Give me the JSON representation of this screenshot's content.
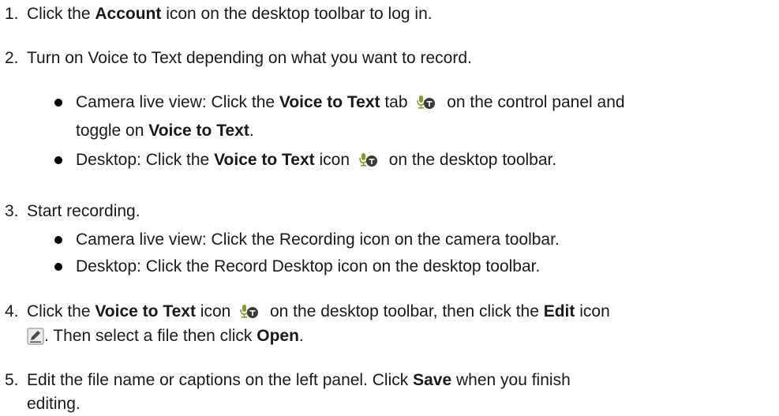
{
  "steps": [
    {
      "num": "1.",
      "t1": "Click the ",
      "b1": "Account",
      "t2": " icon on the desktop toolbar to log in."
    },
    {
      "num": "2.",
      "text": "Turn on Voice to Text depending on what you want to record.",
      "bullets": [
        {
          "t1": "Camera live view: Click the ",
          "b1": "Voice to Text",
          "t2": " tab ",
          "t3": " on the control panel and",
          "l2_t1": "toggle on ",
          "l2_b1": "Voice to Text",
          "l2_t2": "."
        },
        {
          "t1": "Desktop: Click the ",
          "b1": "Voice to Text",
          "t2": " icon ",
          "t3": " on the desktop toolbar."
        }
      ]
    },
    {
      "num": "3.",
      "text": "Start recording.",
      "bullets": [
        {
          "text": "Camera live view: Click the Recording icon on the camera toolbar."
        },
        {
          "text": "Desktop: Click the Record Desktop icon on the desktop toolbar."
        }
      ]
    },
    {
      "num": "4.",
      "t1": "Click the ",
      "b1": "Voice to Text",
      "t2": " icon ",
      "t3": " on the desktop toolbar, then click the ",
      "b2": "Edit",
      "t4": " icon",
      "l2_t1": ". Then select a file then click ",
      "l2_b1": "Open",
      "l2_t2": "."
    },
    {
      "num": "5.",
      "t1": "Edit the file name or captions on the left panel. Click ",
      "b1": "Save",
      "t2": " when you finish",
      "l2": "editing."
    }
  ],
  "icons": {
    "voice_to_text": "voice-to-text-icon",
    "edit": "edit-icon"
  },
  "colors": {
    "text": "#1a1a1a",
    "icon_green": "#8a9a2a",
    "icon_dark": "#3a3a3a"
  }
}
